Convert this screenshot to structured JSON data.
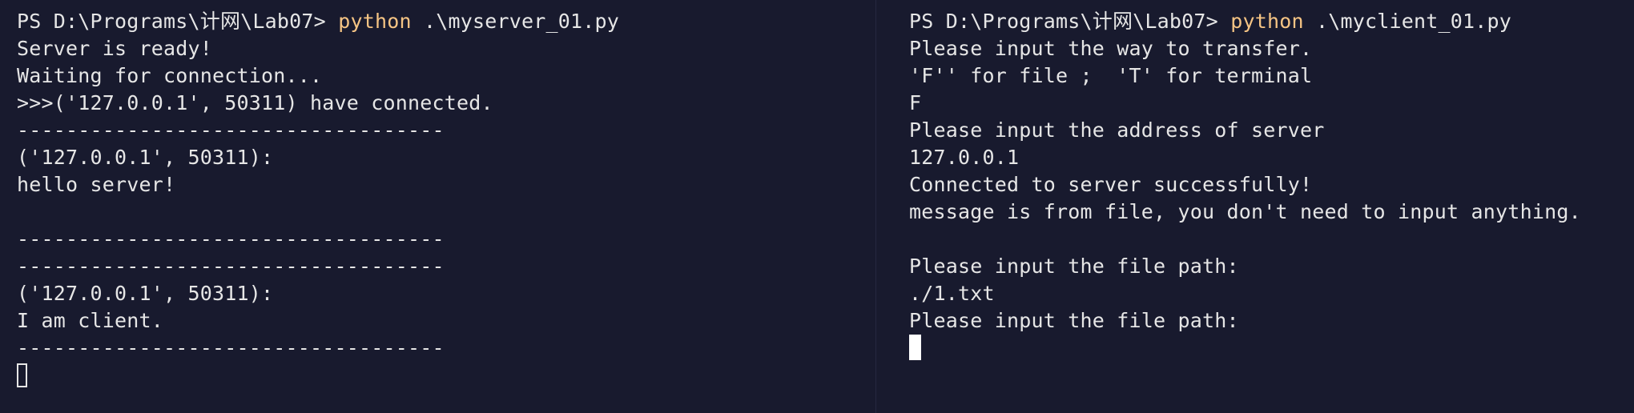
{
  "colors": {
    "background": "#181a2e",
    "text": "#e6e6e6",
    "command": "#f5c484",
    "cursor": "#ffffff"
  },
  "server_pane": {
    "prompt": "PS D:\\Programs\\计网\\Lab07> ",
    "command": "python",
    "args": " .\\myserver_01.py",
    "lines": [
      "Server is ready!",
      "Waiting for connection...",
      ">>>('127.0.0.1', 50311) have connected.",
      "-----------------------------------",
      "('127.0.0.1', 50311):",
      "hello server!",
      "",
      "-----------------------------------",
      "-----------------------------------",
      "('127.0.0.1', 50311):",
      "I am client.",
      "-----------------------------------"
    ]
  },
  "client_pane": {
    "prompt": "PS D:\\Programs\\计网\\Lab07> ",
    "command": "python",
    "args": " .\\myclient_01.py",
    "lines": [
      "Please input the way to transfer.",
      "'F'' for file ;  'T' for terminal",
      "F",
      "Please input the address of server",
      "127.0.0.1",
      "Connected to server successfully!",
      "message is from file, you don't need to input anything.",
      "",
      "Please input the file path:",
      "./1.txt",
      "Please input the file path:"
    ]
  }
}
